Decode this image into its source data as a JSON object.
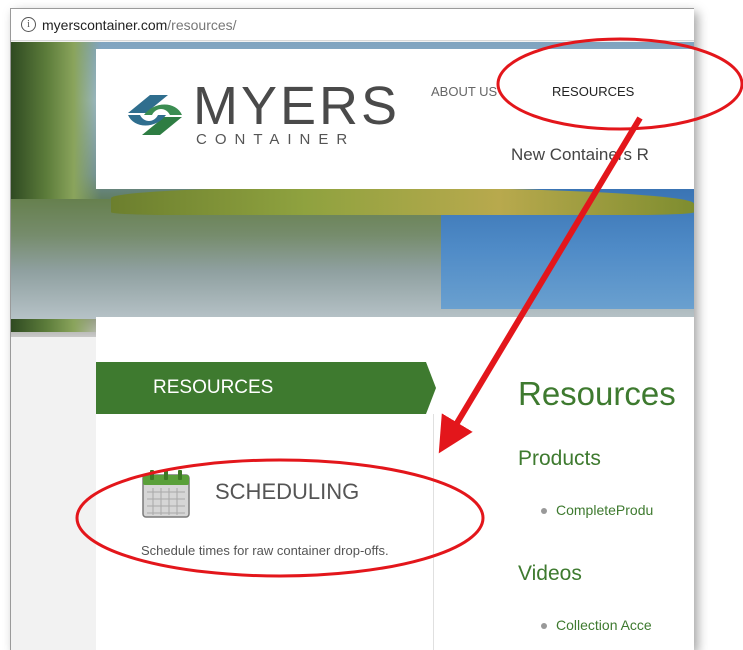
{
  "browser": {
    "url_domain": "myerscontainer.com",
    "url_path": "/resources/",
    "info_glyph": "i"
  },
  "header": {
    "logo_text": "MYERS",
    "logo_subtext": "CONTAINER",
    "nav": {
      "about": "ABOUT US",
      "resources": "RESOURCES"
    },
    "subnav": "New Containers   R"
  },
  "sidebar": {
    "tab_label": "RESOURCES",
    "item": {
      "icon": "calendar-icon",
      "label": "SCHEDULING",
      "description": "Schedule times for raw container drop-offs."
    }
  },
  "main": {
    "title": "Resources",
    "sections": [
      {
        "heading": "Products",
        "items": [
          "CompleteProdu"
        ]
      },
      {
        "heading": "Videos",
        "items": [
          "Collection Acce"
        ]
      }
    ]
  },
  "annotations": {
    "color": "#e3161b"
  },
  "colors": {
    "brand_green": "#3e7a2f",
    "logo_green": "#2e8b57"
  }
}
